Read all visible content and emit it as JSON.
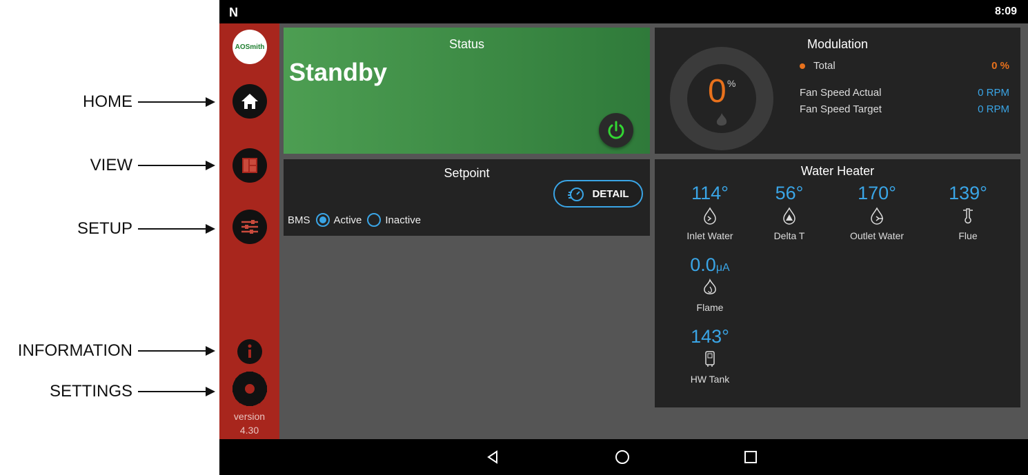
{
  "annotations": [
    {
      "label": "HOME"
    },
    {
      "label": "VIEW"
    },
    {
      "label": "SETUP"
    },
    {
      "label": "INFORMATION"
    },
    {
      "label": "SETTINGS"
    }
  ],
  "status_bar": {
    "logo": "N",
    "clock": "8:09"
  },
  "sidebar": {
    "logo_text": "AOSmith",
    "items": [
      {
        "name": "home",
        "icon": "home-icon"
      },
      {
        "name": "view",
        "icon": "layout-grid-icon"
      },
      {
        "name": "setup",
        "icon": "sliders-icon"
      },
      {
        "name": "information",
        "icon": "info-icon"
      },
      {
        "name": "settings",
        "icon": "gear-icon"
      }
    ],
    "version_label": "version",
    "version_number": "4.30"
  },
  "status_panel": {
    "title": "Status",
    "state": "Standby"
  },
  "modulation": {
    "title": "Modulation",
    "gauge_value": "0",
    "gauge_unit": "%",
    "rows": [
      {
        "label": "Total",
        "value": "0 %",
        "color": "#e8711c"
      },
      {
        "label": "Fan Speed Actual",
        "value": "0 RPM",
        "color": "#3aa5e6"
      },
      {
        "label": "Fan Speed Target",
        "value": "0 RPM",
        "color": "#3aa5e6"
      }
    ]
  },
  "setpoint": {
    "title": "Setpoint",
    "detail_label": "DETAIL",
    "bms_label": "BMS",
    "options": [
      {
        "label": "Active",
        "selected": true
      },
      {
        "label": "Inactive",
        "selected": false
      }
    ]
  },
  "water_heater": {
    "title": "Water Heater",
    "sensors": [
      {
        "value": "114°",
        "label": "Inlet Water",
        "icon": "inlet-water-icon"
      },
      {
        "value": "56°",
        "label": "Delta T",
        "icon": "delta-drop-icon"
      },
      {
        "value": "170°",
        "label": "Outlet Water",
        "icon": "outlet-water-icon"
      },
      {
        "value": "139°",
        "label": "Flue",
        "icon": "thermometer-icon"
      },
      {
        "value": "0.0",
        "unit": "μA",
        "label": "Flame",
        "icon": "flame-icon"
      },
      {
        "value": "143°",
        "label": "HW Tank",
        "icon": "tank-icon"
      }
    ]
  },
  "colors": {
    "sidebar": "#a8261d",
    "accent": "#3aa5e6",
    "orange": "#e8711c",
    "status_green": "#4d9e52"
  }
}
